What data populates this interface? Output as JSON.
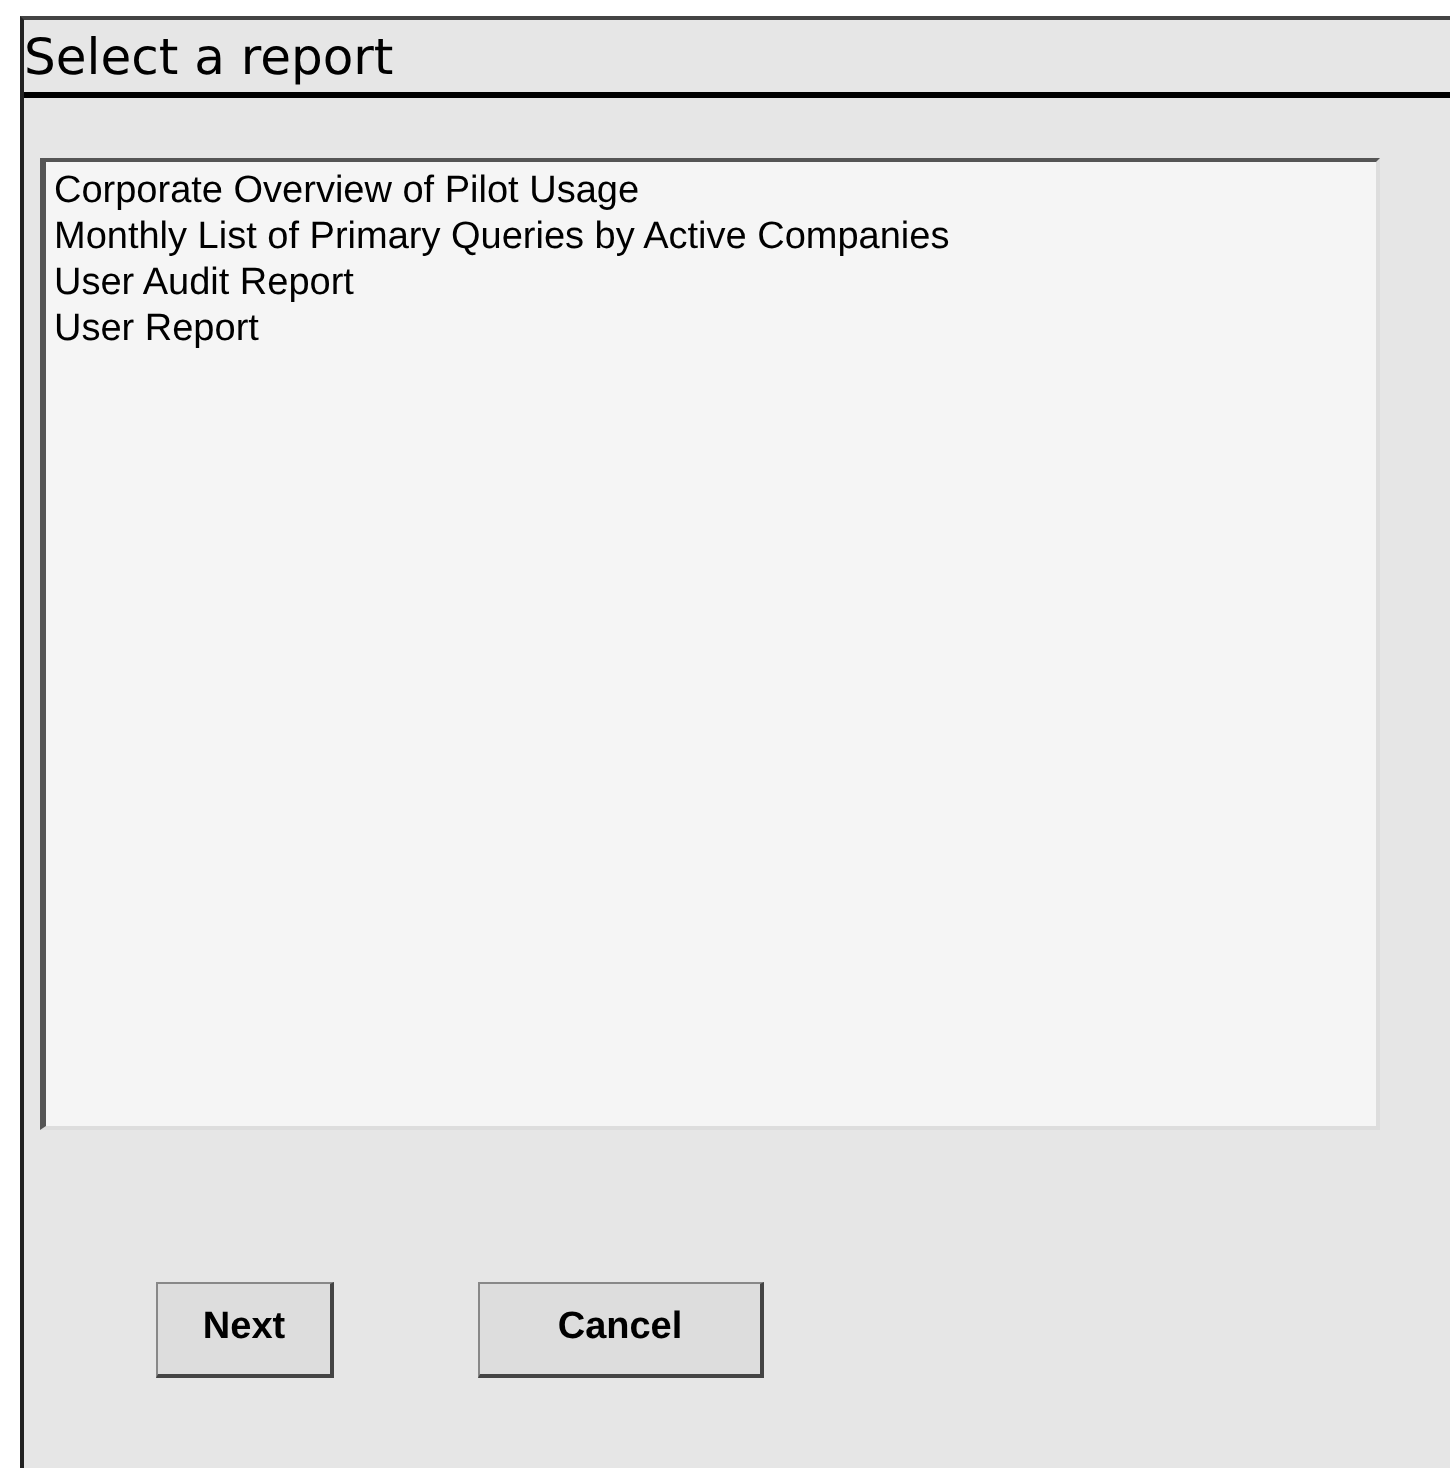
{
  "title": "Select a report",
  "reports": [
    {
      "label": "Corporate Overview of Pilot Usage"
    },
    {
      "label": "Monthly List of Primary Queries by Active Companies"
    },
    {
      "label": "User Audit Report"
    },
    {
      "label": "User Report"
    }
  ],
  "buttons": [
    "Next",
    "Cancel"
  ]
}
